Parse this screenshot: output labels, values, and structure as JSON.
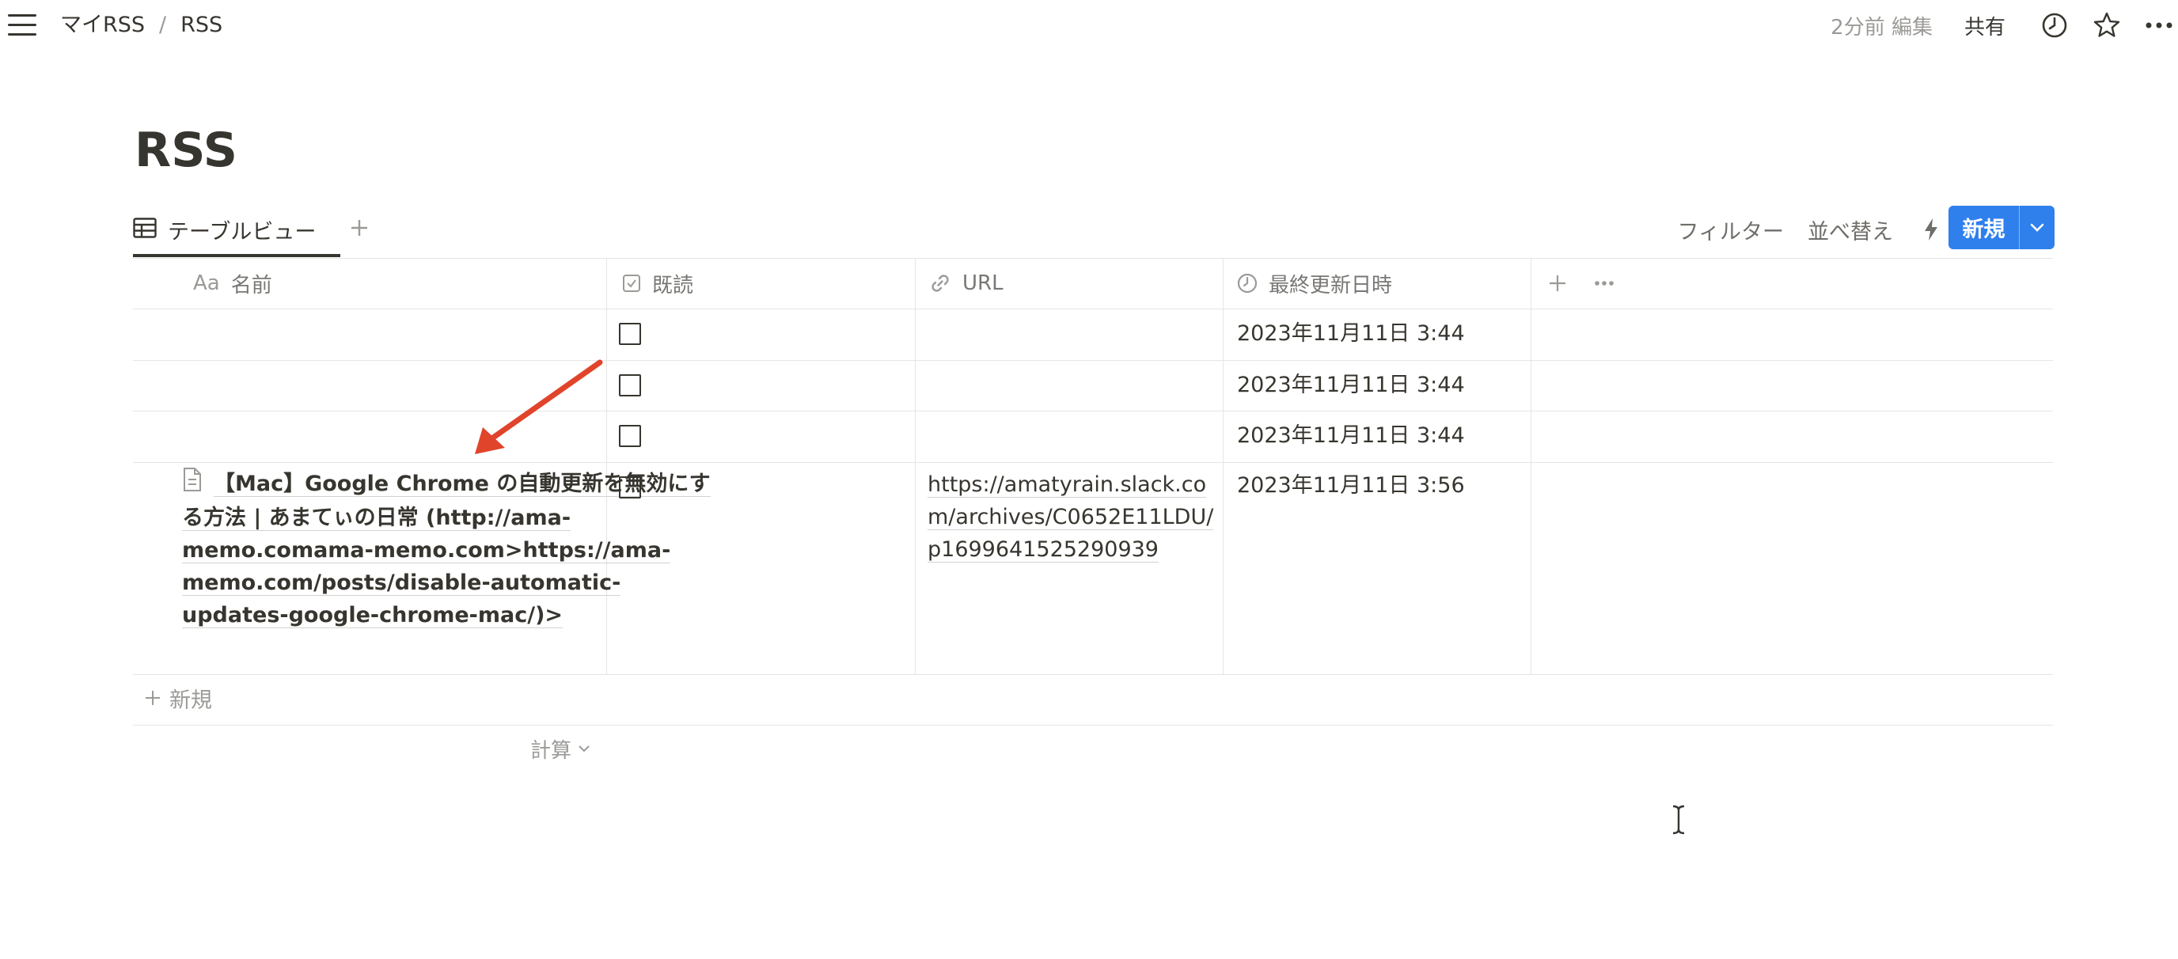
{
  "breadcrumb": {
    "workspace": "マイRSS",
    "separator": "/",
    "page": "RSS"
  },
  "header": {
    "edited_text": "2分前 編集",
    "share_label": "共有"
  },
  "page": {
    "title": "RSS"
  },
  "view": {
    "tab_label": "テーブルビュー"
  },
  "toolbar": {
    "filter_label": "フィルター",
    "sort_label": "並べ替え",
    "new_label": "新規"
  },
  "table": {
    "columns": [
      {
        "prefix": "Aa",
        "label": "名前"
      },
      {
        "label": "既読"
      },
      {
        "label": "URL"
      },
      {
        "label": "最終更新日時"
      }
    ],
    "rows": [
      {
        "name": "",
        "read": false,
        "url": "",
        "updated": "2023年11月11日 3:44"
      },
      {
        "name": "",
        "read": false,
        "url": "",
        "updated": "2023年11月11日 3:44"
      },
      {
        "name": "",
        "read": false,
        "url": "",
        "updated": "2023年11月11日 3:44"
      },
      {
        "name": "【Mac】Google Chrome の自動更新を無効にする方法 | あまてぃの日常 (http://ama-memo.comama-memo.com>https://ama-memo.com/posts/disable-automatic-updates-google-chrome-mac/)>",
        "read": false,
        "url": "https://amatyrain.slack.com/archives/C0652E11LDU/p1699641525290939",
        "updated": "2023年11月11日 3:56"
      }
    ],
    "add_row_label": "新規",
    "calc_label": "計算"
  },
  "colors": {
    "accent": "#2f80ed",
    "text": "#37352f",
    "muted": "#9b9a97",
    "border": "#e6e5e3",
    "arrow": "#e0442b"
  }
}
